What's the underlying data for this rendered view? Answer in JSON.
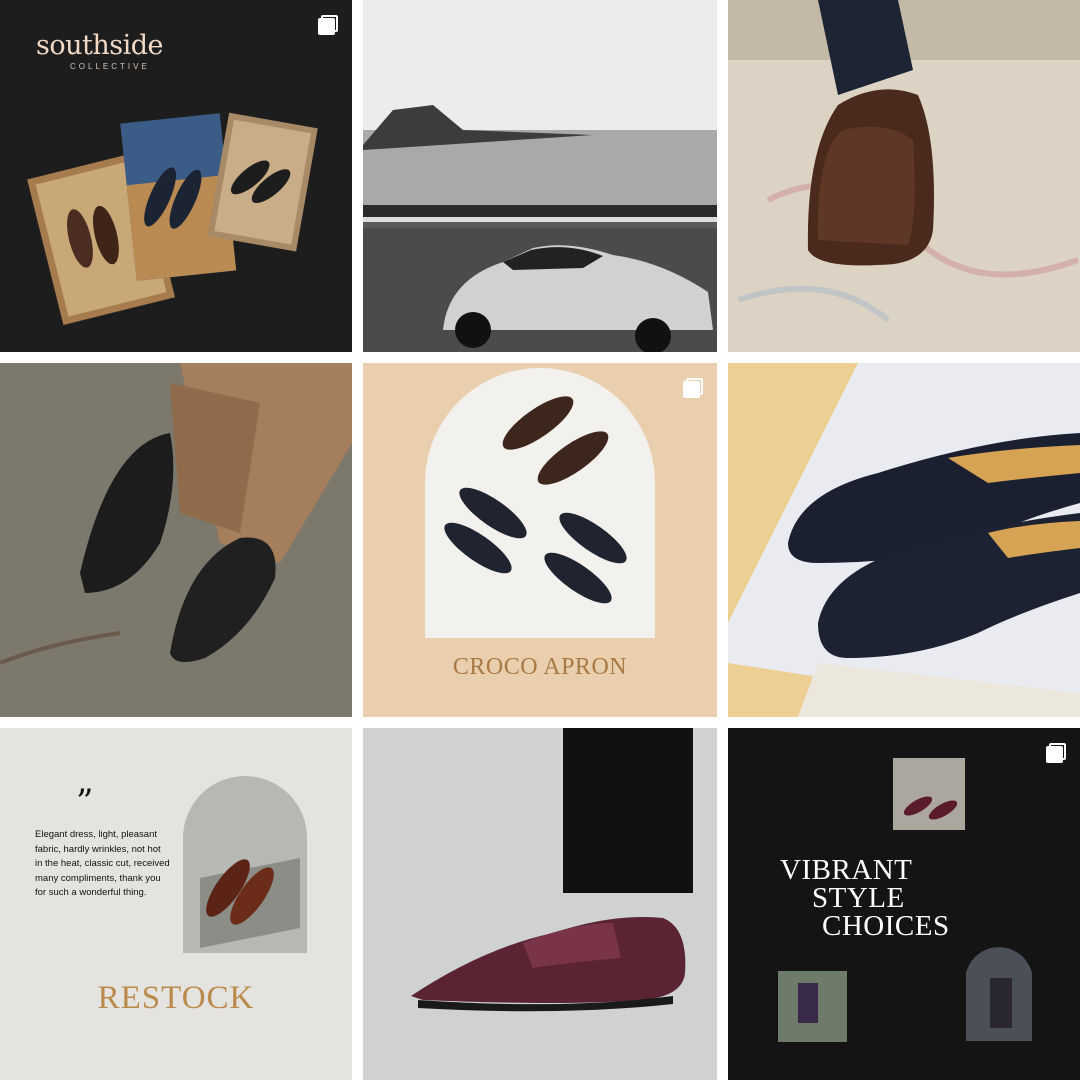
{
  "tile1": {
    "brand": "southside",
    "brand_sub": "COLLECTIVE",
    "multi_icon": "multiple-images-icon"
  },
  "tile5": {
    "caption": "CROCO APRON",
    "multi_icon": "multiple-images-icon"
  },
  "tile7": {
    "quote_mark": "”",
    "review": "Elegant dress, light, pleasant fabric, hardly wrinkles, not hot in the heat, classic cut, received many compliments, thank you for such a wonderful thing.",
    "heading": "RESTOCK"
  },
  "tile9": {
    "line1": "VIBRANT",
    "line2": "STYLE",
    "line3": "CHOICES",
    "multi_icon": "multiple-images-icon"
  },
  "colors": {
    "accent_gold": "#b98a4b",
    "dark_tile": "#141414",
    "beige_tile": "#e9cfae"
  }
}
